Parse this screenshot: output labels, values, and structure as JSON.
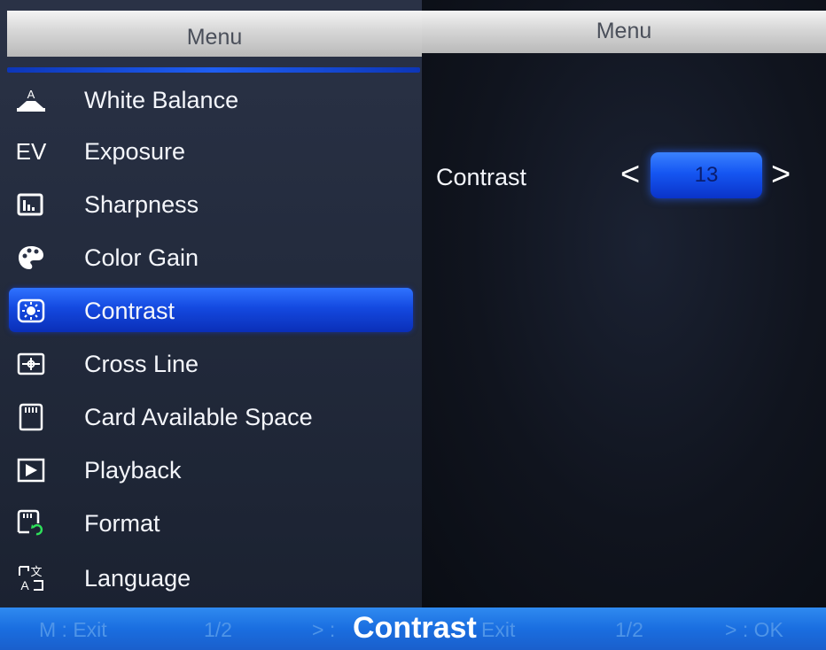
{
  "left_panel": {
    "title": "Menu",
    "items": [
      {
        "label": "White Balance",
        "icon": "white-balance-icon"
      },
      {
        "label": "Exposure",
        "icon": "ev-icon",
        "icon_text": "EV"
      },
      {
        "label": "Sharpness",
        "icon": "sharpness-icon"
      },
      {
        "label": "Color Gain",
        "icon": "palette-icon"
      },
      {
        "label": "Contrast",
        "icon": "contrast-icon",
        "selected": true
      },
      {
        "label": "Cross Line",
        "icon": "crossline-icon"
      },
      {
        "label": "Card Available Space",
        "icon": "sd-card-icon"
      },
      {
        "label": "Playback",
        "icon": "play-icon"
      },
      {
        "label": "Format",
        "icon": "format-card-icon"
      },
      {
        "label": "Language",
        "icon": "language-icon"
      }
    ]
  },
  "right_panel": {
    "title": "Menu",
    "setting": {
      "label": "Contrast",
      "arrow_left": "<",
      "value": "13",
      "arrow_right": ">"
    }
  },
  "bottom_bar": {
    "left_exit_hint": "M : Exit",
    "left_page": "1/2",
    "left_arrow_hint": "> :",
    "current_title": "Contrast",
    "right_exit_hint": "Exit",
    "right_page": "1/2",
    "right_ok_hint": "> : OK"
  },
  "colors": {
    "accent": "#1449e0",
    "header": "#d9d9d9",
    "bottom_bar": "#1a6ee0"
  }
}
